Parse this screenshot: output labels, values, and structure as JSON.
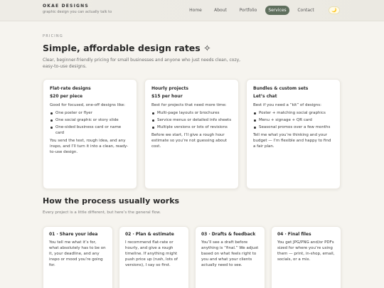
{
  "brand": {
    "title": "OKAE DESIGNS",
    "tagline": "graphic design you can actually talk to"
  },
  "nav": {
    "items": [
      "Home",
      "About",
      "Portfolio",
      "Services",
      "Contact"
    ],
    "active": "Services",
    "theme_icon": "moon-icon",
    "theme_glyph": "🌙"
  },
  "intro": {
    "eyebrow": "PRICING",
    "title": "Simple, affordable design rates ✧",
    "lead": "Clear, beginner-friendly pricing for small businesses and anyone who just needs clean, cozy, easy-to-use designs."
  },
  "pricing": [
    {
      "title": "Flat-rate designs",
      "price": "$20 per piece",
      "intro": "Good for focused, one-off designs like:",
      "items": [
        "One poster or flyer",
        "One social graphic or story slide",
        "One-sided business card or name card"
      ],
      "outro": "You send the text, rough idea, and any inspo, and I’ll turn it into a clean, ready-to-use design."
    },
    {
      "title": "Hourly projects",
      "price": "$15 per hour",
      "intro": "Best for projects that need more time:",
      "items": [
        "Multi-page layouts or brochures",
        "Service menus or detailed info sheets",
        "Multiple versions or lots of revisions"
      ],
      "outro": "Before we start, I’ll give a rough hour estimate so you’re not guessing about cost."
    },
    {
      "title": "Bundles & custom sets",
      "price": "Let’s chat",
      "intro": "Best if you need a “kit” of designs:",
      "items": [
        "Poster + matching social graphics",
        "Menu + signage + QR card",
        "Seasonal promos over a few months"
      ],
      "outro": "Tell me what you’re thinking and your budget — I’m flexible and happy to find a fair plan."
    }
  ],
  "process": {
    "title": "How the process usually works",
    "subtitle": "Every project is a little different, but here’s the general flow.",
    "steps": [
      {
        "title": "01 · Share your idea",
        "text": "You tell me what it’s for, what absolutely has to be on it, your deadline, and any inspo or mood you’re going for."
      },
      {
        "title": "02 · Plan & estimate",
        "text": "I recommend flat-rate or hourly, and give a rough timeline. If anything might push price up (rush, lots of versions), I say so first."
      },
      {
        "title": "03 · Drafts & feedback",
        "text": "You’ll see a draft before anything is “final.” We adjust based on what feels right to you and what your clients actually need to see."
      },
      {
        "title": "04 · Final files",
        "text": "You get JPG/PNG and/or PDFs sized for where you’re using them — print, in-shop, email, socials, or a mix."
      }
    ]
  },
  "colors": {
    "background": "#f6f4ef",
    "accent": "#5f6f5d",
    "card": "#ffffff"
  }
}
